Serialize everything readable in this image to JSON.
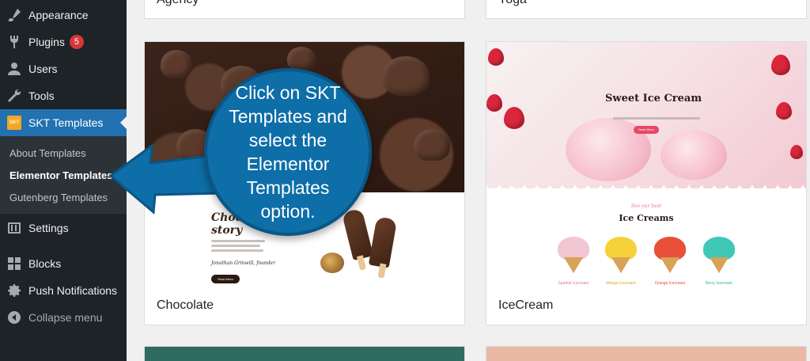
{
  "sidebar": {
    "items": [
      {
        "label": "Appearance",
        "icon": "paintbrush-icon"
      },
      {
        "label": "Plugins",
        "icon": "plugin-icon",
        "badge": "5"
      },
      {
        "label": "Users",
        "icon": "user-icon"
      },
      {
        "label": "Tools",
        "icon": "wrench-icon"
      },
      {
        "label": "SKT Templates",
        "icon": "skt-logo-icon",
        "logo_text": "SKT"
      },
      {
        "label": "Settings",
        "icon": "settings-sliders-icon"
      },
      {
        "label": "Blocks",
        "icon": "blocks-icon"
      },
      {
        "label": "Push Notifications",
        "icon": "gear-icon"
      },
      {
        "label": "Collapse menu",
        "icon": "collapse-arrow-icon"
      }
    ],
    "submenu": [
      {
        "label": "About Templates"
      },
      {
        "label": "Elementor Templates",
        "current": true
      },
      {
        "label": "Gutenberg Templates"
      }
    ],
    "colors": {
      "background": "#1d2327",
      "active": "#2271b1",
      "submenu_bg": "#2c3338",
      "badge": "#d63638"
    }
  },
  "templates": {
    "top_cards": [
      {
        "title": "Agency"
      },
      {
        "title": "Yoga"
      }
    ],
    "cards": [
      {
        "title": "Chocolate",
        "preview": {
          "heading": "Chocolate story",
          "signature": "Jonathan Grinwill, founder",
          "button": "Read More"
        }
      },
      {
        "title": "IceCream",
        "preview": {
          "heading": "Sweet Ice Cream",
          "button": "Read More",
          "section_label": "See our best",
          "section_title": "Ice Creams",
          "flavors": [
            {
              "name": "Sparkle Icecream",
              "color": "#f3c6d4"
            },
            {
              "name": "Mango Icecream",
              "color": "#f5d23a"
            },
            {
              "name": "Orange Icecream",
              "color": "#e8503a"
            },
            {
              "name": "Berry Icecream",
              "color": "#3fc7b8"
            }
          ]
        }
      }
    ]
  },
  "callout": {
    "text": "Click on SKT Templates and select the Elementor Templates option.",
    "color": "#0e6ea8"
  }
}
